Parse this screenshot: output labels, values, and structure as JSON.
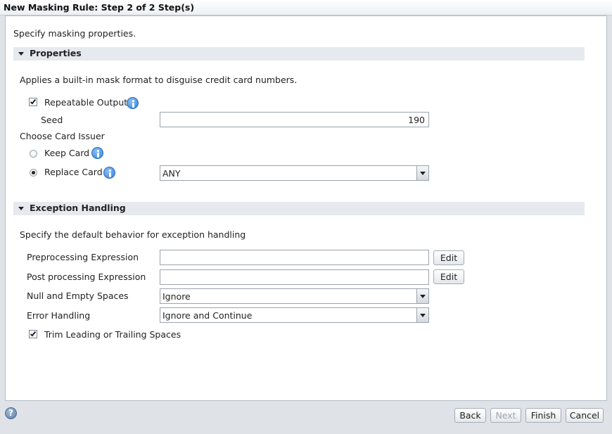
{
  "dialog": {
    "title": "New Masking Rule: Step 2 of 2 Step(s)",
    "instruction": "Specify masking properties."
  },
  "properties": {
    "header": "Properties",
    "description": "Applies a built-in mask format to disguise credit card numbers.",
    "repeatable_output": {
      "label": "Repeatable Output",
      "checked": true
    },
    "seed": {
      "label": "Seed",
      "value": "190"
    },
    "card_issuer_label": "Choose Card Issuer",
    "keep_card": {
      "label": "Keep Card",
      "selected": false
    },
    "replace_card": {
      "label": "Replace Card",
      "selected": true,
      "value": "ANY"
    }
  },
  "exception_handling": {
    "header": "Exception Handling",
    "description": "Specify the default behavior for exception handling",
    "preprocessing": {
      "label": "Preprocessing Expression",
      "value": "",
      "edit_label": "Edit"
    },
    "postprocessing": {
      "label": "Post processing Expression",
      "value": "",
      "edit_label": "Edit"
    },
    "null_empty": {
      "label": "Null and Empty Spaces",
      "value": "Ignore"
    },
    "error_handling": {
      "label": "Error Handling",
      "value": "Ignore and Continue"
    },
    "trim_spaces": {
      "label": "Trim Leading or Trailing Spaces",
      "checked": true
    }
  },
  "footer": {
    "help_icon": "?",
    "back": "Back",
    "next": "Next",
    "finish": "Finish",
    "cancel": "Cancel"
  },
  "colors": {
    "section_header_bg": "#e6e9ed",
    "info_icon": "#2f7fd6",
    "background": "#dfe3e8"
  },
  "icons": [
    "info-icon",
    "collapse-triangle-icon",
    "help-icon",
    "dropdown-arrow-icon"
  ]
}
